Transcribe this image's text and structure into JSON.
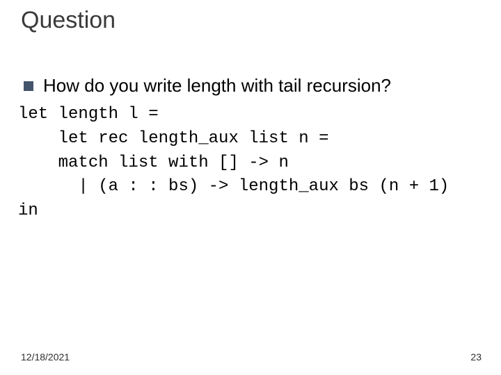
{
  "slide": {
    "title": "Question",
    "bullet_text": "How do you write length with tail recursion?",
    "code_lines": [
      "let length l =",
      "    let rec length_aux list n =",
      "    match list with [] -> n",
      "      | (a : : bs) -> length_aux bs (n + 1)",
      "in"
    ],
    "footer_date": "12/18/2021",
    "page_number": "23"
  }
}
